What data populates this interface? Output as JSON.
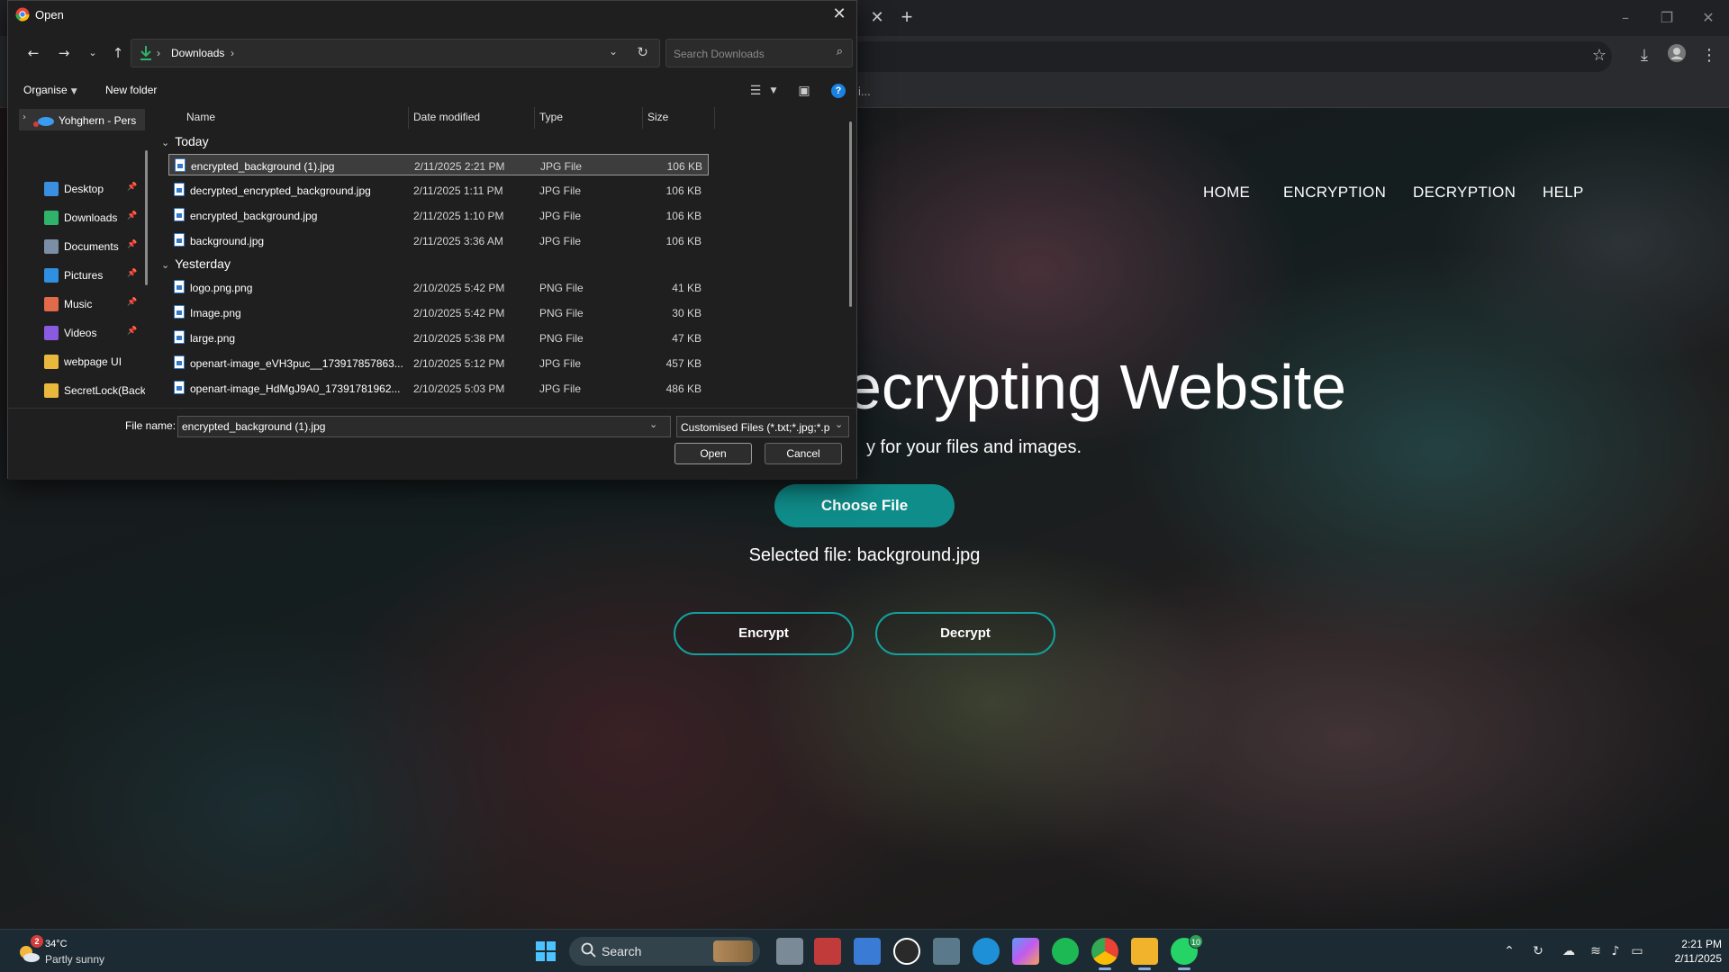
{
  "dialog": {
    "title": "Open",
    "breadcrumb": "Downloads",
    "search_placeholder": "Search Downloads",
    "cmd": {
      "organise": "Organise",
      "new_folder": "New folder"
    },
    "nav_pane": {
      "onedrive": "Yohghern - Pers",
      "items": [
        {
          "label": "Desktop",
          "color": "#3b8fe0",
          "pinned": true
        },
        {
          "label": "Downloads",
          "color": "#2fb36a",
          "pinned": true
        },
        {
          "label": "Documents",
          "color": "#7a8ea6",
          "pinned": true
        },
        {
          "label": "Pictures",
          "color": "#2f8fe0",
          "pinned": true
        },
        {
          "label": "Music",
          "color": "#e06a4a",
          "pinned": true
        },
        {
          "label": "Videos",
          "color": "#8a5ae0",
          "pinned": true
        },
        {
          "label": "webpage UI",
          "color": "#e8b93c",
          "pinned": false
        },
        {
          "label": "SecretLock(Back",
          "color": "#e8b93c",
          "pinned": false
        }
      ]
    },
    "columns": {
      "name": "Name",
      "date": "Date modified",
      "type": "Type",
      "size": "Size"
    },
    "groups": [
      {
        "label": "Today",
        "files": [
          {
            "name": "encrypted_background (1).jpg",
            "date": "2/11/2025 2:21 PM",
            "type": "JPG File",
            "size": "106 KB",
            "selected": true
          },
          {
            "name": "decrypted_encrypted_background.jpg",
            "date": "2/11/2025 1:11 PM",
            "type": "JPG File",
            "size": "106 KB"
          },
          {
            "name": "encrypted_background.jpg",
            "date": "2/11/2025 1:10 PM",
            "type": "JPG File",
            "size": "106 KB"
          },
          {
            "name": "background.jpg",
            "date": "2/11/2025 3:36 AM",
            "type": "JPG File",
            "size": "106 KB"
          }
        ]
      },
      {
        "label": "Yesterday",
        "files": [
          {
            "name": "logo.png.png",
            "date": "2/10/2025 5:42 PM",
            "type": "PNG File",
            "size": "41 KB"
          },
          {
            "name": "Image.png",
            "date": "2/10/2025 5:42 PM",
            "type": "PNG File",
            "size": "30 KB"
          },
          {
            "name": "large.png",
            "date": "2/10/2025 5:38 PM",
            "type": "PNG File",
            "size": "47 KB"
          },
          {
            "name": "openart-image_eVH3puc__173917857863...",
            "date": "2/10/2025 5:12 PM",
            "type": "JPG File",
            "size": "457 KB"
          },
          {
            "name": "openart-image_HdMgJ9A0_17391781962...",
            "date": "2/10/2025 5:03 PM",
            "type": "JPG File",
            "size": "486 KB"
          }
        ]
      }
    ],
    "file_name_label": "File name:",
    "file_name_value": "encrypted_background (1).jpg",
    "filter": "Customised Files (*.txt;*.jpg;*.p",
    "open_label": "Open",
    "cancel_label": "Cancel"
  },
  "browser": {
    "bookmark_fragment": "i...",
    "accent": "#0f8d8a"
  },
  "webpage": {
    "nav": [
      "HOME",
      "ENCRYPTION",
      "DECRYPTION",
      "HELP"
    ],
    "hero_title": "ecrypting Website",
    "hero_sub": "y for your files and images.",
    "choose_file": "Choose File",
    "selected_file": "Selected file: background.jpg",
    "encrypt": "Encrypt",
    "decrypt": "Decrypt"
  },
  "taskbar": {
    "weather_temp": "34°C",
    "weather_desc": "Partly sunny",
    "weather_badge": "2",
    "search_label": "Search",
    "whatsapp_badge": "10",
    "time": "2:21 PM",
    "date": "2/11/2025"
  }
}
